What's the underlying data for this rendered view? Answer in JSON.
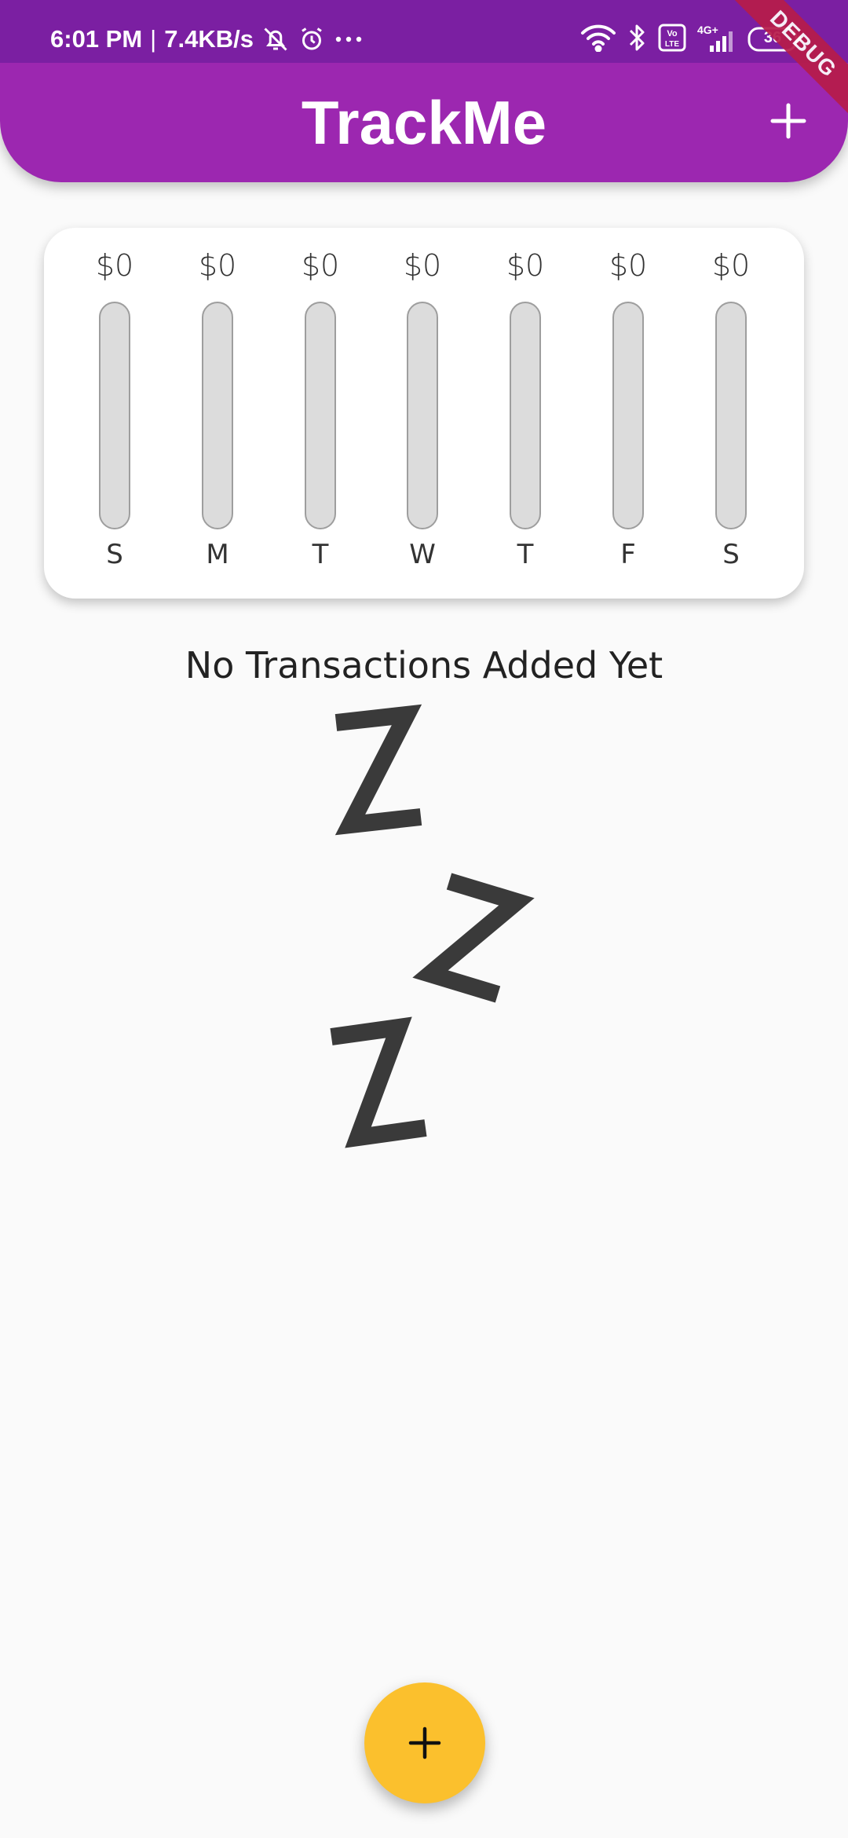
{
  "status_bar": {
    "time": "6:01 PM",
    "separator": "|",
    "net_speed": "7.4KB/s",
    "battery": "36",
    "signal_label": "4G+",
    "volte_label": "Vo LTE",
    "icons": [
      "bell-off-icon",
      "alarm-icon",
      "more-dots-icon",
      "wifi-icon",
      "bluetooth-icon",
      "volte-icon",
      "signal-icon",
      "battery-icon"
    ]
  },
  "app_bar": {
    "title": "TrackMe",
    "add_icon": "plus-icon",
    "color": "#9c27b0",
    "status_color": "#7b1fa2"
  },
  "debug_banner": "DEBUG",
  "chart_data": {
    "type": "bar",
    "categories": [
      "S",
      "M",
      "T",
      "W",
      "T",
      "F",
      "S"
    ],
    "values": [
      0,
      0,
      0,
      0,
      0,
      0,
      0
    ],
    "value_labels": [
      "$0",
      "$0",
      "$0",
      "$0",
      "$0",
      "$0",
      "$0"
    ],
    "ylim": [
      0,
      1
    ],
    "fill_color": "#9c27b0",
    "track_color": "#dcdcdc"
  },
  "empty_state": {
    "message": "No Transactions Added Yet",
    "image": "sleeping-zzz-illustration"
  },
  "fab": {
    "icon": "plus-icon",
    "color": "#fbc02d"
  }
}
